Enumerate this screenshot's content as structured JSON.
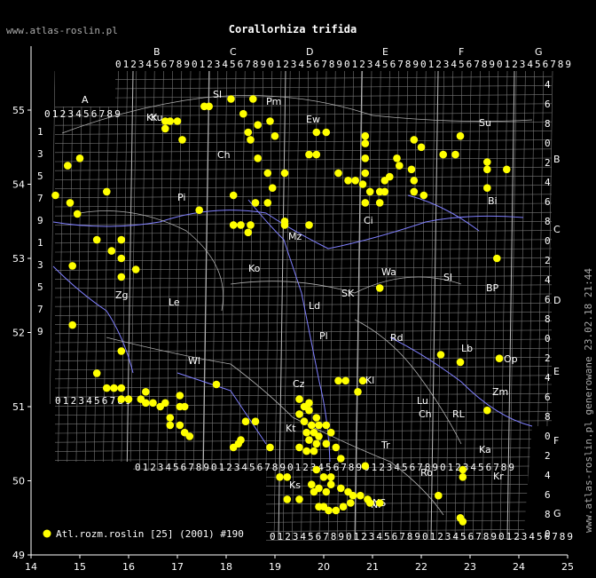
{
  "site_top": "www.atlas-roslin.pl",
  "site_side": "www.atlas-roslin.pl generowane 23.02.18 21:44",
  "title": "Corallorhiza trifida",
  "legend": {
    "label": "Atl.rozm.roslin [25] (2001) #190",
    "color": "#ffff00"
  },
  "colors": {
    "background": "#000000",
    "grid": "#777777",
    "rivers": "#8080ff",
    "borders": "#b0b0b0",
    "points": "#ffff00",
    "labels": "#808080"
  },
  "axes": {
    "x_ticks": [
      "14",
      "15",
      "16",
      "17",
      "18",
      "19",
      "20",
      "21",
      "22",
      "23",
      "24",
      "25"
    ],
    "y_ticks": [
      "55",
      "54",
      "53",
      "52",
      "51",
      "50",
      "49"
    ],
    "xlim": [
      14,
      25
    ],
    "ylim": [
      49,
      55.5
    ]
  },
  "col_letters": [
    "A",
    "B",
    "C",
    "D",
    "E",
    "F",
    "G"
  ],
  "right_letters": [
    "B",
    "C",
    "D",
    "E",
    "F",
    "G"
  ],
  "digit_row": "0123456789",
  "region_labels": [
    "Kr",
    "Sl",
    "Pm",
    "Ch",
    "Pi",
    "Ku",
    "Ew",
    "Su",
    "Bi",
    "Ci",
    "Mz",
    "Wa",
    "Sl",
    "BP",
    "Zg",
    "Le",
    "Ko",
    "Ld",
    "SK",
    "Wl",
    "Pl",
    "Rd",
    "Lb",
    "Op",
    "Cz",
    "Kl",
    "Lu",
    "Ch",
    "Zm",
    "Kt",
    "Tr",
    "Ks",
    "Ni",
    "Ro",
    "NS",
    "Kr",
    "RL",
    "Ka"
  ],
  "points": [
    [
      14.5,
      53.85
    ],
    [
      14.75,
      54.25
    ],
    [
      15.0,
      54.35
    ],
    [
      14.8,
      53.75
    ],
    [
      14.95,
      53.6
    ],
    [
      15.55,
      53.9
    ],
    [
      15.35,
      53.25
    ],
    [
      15.85,
      53.25
    ],
    [
      15.65,
      53.1
    ],
    [
      15.85,
      53.0
    ],
    [
      14.85,
      52.9
    ],
    [
      15.85,
      52.75
    ],
    [
      16.15,
      52.85
    ],
    [
      14.85,
      52.1
    ],
    [
      15.85,
      51.75
    ],
    [
      15.35,
      51.45
    ],
    [
      15.55,
      51.25
    ],
    [
      15.7,
      51.25
    ],
    [
      15.85,
      51.25
    ],
    [
      15.85,
      51.1
    ],
    [
      16.0,
      51.1
    ],
    [
      16.25,
      51.1
    ],
    [
      16.35,
      51.2
    ],
    [
      16.35,
      51.05
    ],
    [
      16.5,
      51.05
    ],
    [
      16.65,
      51.0
    ],
    [
      16.75,
      51.05
    ],
    [
      16.85,
      50.85
    ],
    [
      16.85,
      50.75
    ],
    [
      17.05,
      51.15
    ],
    [
      17.05,
      51.0
    ],
    [
      17.15,
      51.0
    ],
    [
      17.05,
      50.75
    ],
    [
      17.15,
      50.65
    ],
    [
      17.25,
      50.6
    ],
    [
      17.8,
      51.3
    ],
    [
      18.15,
      50.45
    ],
    [
      18.25,
      50.5
    ],
    [
      18.3,
      50.55
    ],
    [
      18.4,
      50.8
    ],
    [
      18.6,
      50.8
    ],
    [
      18.9,
      50.45
    ],
    [
      16.75,
      54.85
    ],
    [
      16.85,
      54.85
    ],
    [
      17.0,
      54.85
    ],
    [
      16.75,
      54.75
    ],
    [
      17.1,
      54.6
    ],
    [
      17.55,
      55.05
    ],
    [
      17.65,
      55.05
    ],
    [
      18.1,
      55.15
    ],
    [
      18.35,
      54.95
    ],
    [
      18.55,
      55.15
    ],
    [
      18.45,
      54.7
    ],
    [
      18.65,
      54.8
    ],
    [
      18.9,
      54.85
    ],
    [
      18.5,
      54.6
    ],
    [
      19.0,
      54.65
    ],
    [
      18.65,
      54.35
    ],
    [
      18.85,
      54.15
    ],
    [
      19.2,
      54.15
    ],
    [
      18.15,
      53.85
    ],
    [
      18.95,
      53.95
    ],
    [
      18.6,
      53.75
    ],
    [
      18.85,
      53.75
    ],
    [
      17.45,
      53.65
    ],
    [
      18.15,
      53.45
    ],
    [
      18.3,
      53.45
    ],
    [
      18.5,
      53.45
    ],
    [
      18.45,
      53.35
    ],
    [
      19.2,
      53.5
    ],
    [
      19.2,
      53.45
    ],
    [
      19.7,
      53.45
    ],
    [
      19.85,
      54.7
    ],
    [
      20.05,
      54.7
    ],
    [
      19.7,
      54.4
    ],
    [
      19.85,
      54.4
    ],
    [
      20.3,
      54.15
    ],
    [
      20.5,
      54.05
    ],
    [
      20.65,
      54.05
    ],
    [
      20.8,
      54.0
    ],
    [
      20.95,
      53.9
    ],
    [
      21.15,
      53.9
    ],
    [
      20.85,
      53.75
    ],
    [
      21.15,
      53.75
    ],
    [
      21.25,
      53.9
    ],
    [
      21.25,
      54.05
    ],
    [
      21.35,
      54.1
    ],
    [
      21.55,
      54.25
    ],
    [
      21.8,
      54.2
    ],
    [
      21.85,
      54.05
    ],
    [
      21.85,
      53.9
    ],
    [
      22.05,
      53.85
    ],
    [
      20.85,
      54.65
    ],
    [
      20.85,
      54.55
    ],
    [
      20.85,
      54.35
    ],
    [
      20.85,
      54.15
    ],
    [
      21.5,
      54.35
    ],
    [
      21.85,
      54.6
    ],
    [
      22.0,
      54.5
    ],
    [
      22.45,
      54.4
    ],
    [
      22.7,
      54.4
    ],
    [
      22.8,
      54.65
    ],
    [
      23.35,
      54.3
    ],
    [
      23.35,
      54.2
    ],
    [
      23.35,
      53.95
    ],
    [
      23.75,
      54.2
    ],
    [
      23.55,
      53.0
    ],
    [
      21.15,
      52.6
    ],
    [
      22.4,
      51.7
    ],
    [
      22.8,
      51.6
    ],
    [
      23.6,
      51.65
    ],
    [
      23.35,
      50.95
    ],
    [
      20.8,
      51.35
    ],
    [
      20.7,
      51.2
    ],
    [
      20.3,
      51.35
    ],
    [
      20.45,
      51.35
    ],
    [
      19.5,
      51.1
    ],
    [
      19.7,
      51.05
    ],
    [
      19.6,
      51.0
    ],
    [
      19.5,
      50.9
    ],
    [
      19.7,
      50.95
    ],
    [
      19.85,
      50.85
    ],
    [
      19.6,
      50.8
    ],
    [
      19.75,
      50.75
    ],
    [
      19.9,
      50.75
    ],
    [
      20.05,
      50.75
    ],
    [
      20.15,
      50.65
    ],
    [
      19.65,
      50.65
    ],
    [
      19.8,
      50.65
    ],
    [
      19.9,
      50.6
    ],
    [
      19.7,
      50.55
    ],
    [
      19.85,
      50.5
    ],
    [
      20.05,
      50.5
    ],
    [
      20.25,
      50.45
    ],
    [
      19.5,
      50.45
    ],
    [
      19.65,
      50.4
    ],
    [
      19.8,
      50.4
    ],
    [
      20.35,
      50.3
    ],
    [
      19.1,
      50.05
    ],
    [
      19.25,
      50.05
    ],
    [
      19.85,
      50.15
    ],
    [
      20.0,
      50.05
    ],
    [
      20.15,
      50.05
    ],
    [
      19.75,
      49.95
    ],
    [
      19.9,
      49.9
    ],
    [
      20.05,
      49.85
    ],
    [
      19.8,
      49.85
    ],
    [
      20.15,
      49.95
    ],
    [
      20.35,
      49.9
    ],
    [
      20.5,
      49.85
    ],
    [
      20.6,
      49.8
    ],
    [
      20.75,
      49.8
    ],
    [
      20.9,
      49.75
    ],
    [
      20.55,
      49.7
    ],
    [
      20.4,
      49.65
    ],
    [
      20.25,
      49.6
    ],
    [
      20.1,
      49.6
    ],
    [
      20.0,
      49.65
    ],
    [
      19.9,
      49.65
    ],
    [
      21.15,
      49.7
    ],
    [
      20.95,
      49.7
    ],
    [
      20.85,
      50.2
    ],
    [
      19.25,
      49.75
    ],
    [
      19.5,
      49.75
    ],
    [
      22.35,
      49.8
    ],
    [
      22.85,
      50.15
    ],
    [
      22.85,
      50.05
    ],
    [
      22.8,
      49.5
    ],
    [
      22.85,
      49.45
    ]
  ]
}
